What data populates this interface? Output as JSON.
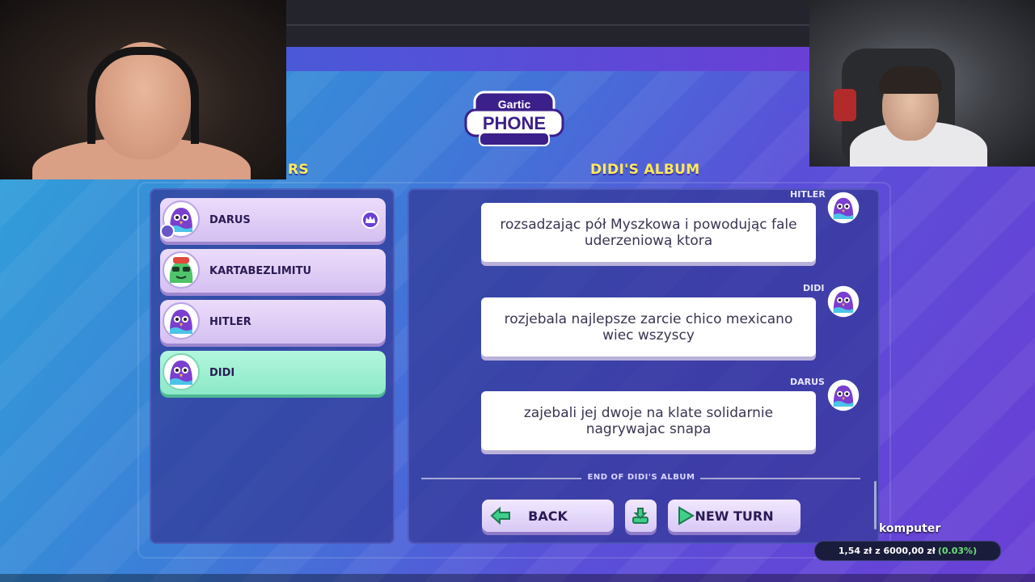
{
  "header": {
    "logo_line1": "Gartic",
    "logo_line2": "PHONE"
  },
  "players": {
    "title": "RS",
    "items": [
      {
        "name": "DARUS",
        "host": true,
        "active": false
      },
      {
        "name": "KARTABEZLIMITU",
        "host": false,
        "active": false
      },
      {
        "name": "HITLER",
        "host": false,
        "active": false
      },
      {
        "name": "DIDI",
        "host": false,
        "active": true
      }
    ]
  },
  "album": {
    "title": "DIDI'S ALBUM",
    "messages": [
      {
        "author": "HITLER",
        "text": "rozsadzając pół Myszkowa i powodując fale uderzeniową ktora"
      },
      {
        "author": "DIDI",
        "text": "rozjebala najlepsze zarcie chico mexicano wiec wszyscy"
      },
      {
        "author": "DARUS",
        "text": "zajebali jej dwoje na klate solidarnie nagrywajac snapa"
      }
    ],
    "end_label": "END OF DIDI'S ALBUM"
  },
  "buttons": {
    "back": "BACK",
    "new_turn": "NEW TURN"
  },
  "donation": {
    "title": "komputer",
    "amount": "1,54 zł",
    "of": "z",
    "goal": "6000,00 zł",
    "percent": "(0.03%)",
    "progress_fraction": 0.0003
  },
  "colors": {
    "accent_yellow": "#ffe95a",
    "active_green": "#8ce9c7",
    "purple": "#6a3fd6"
  }
}
